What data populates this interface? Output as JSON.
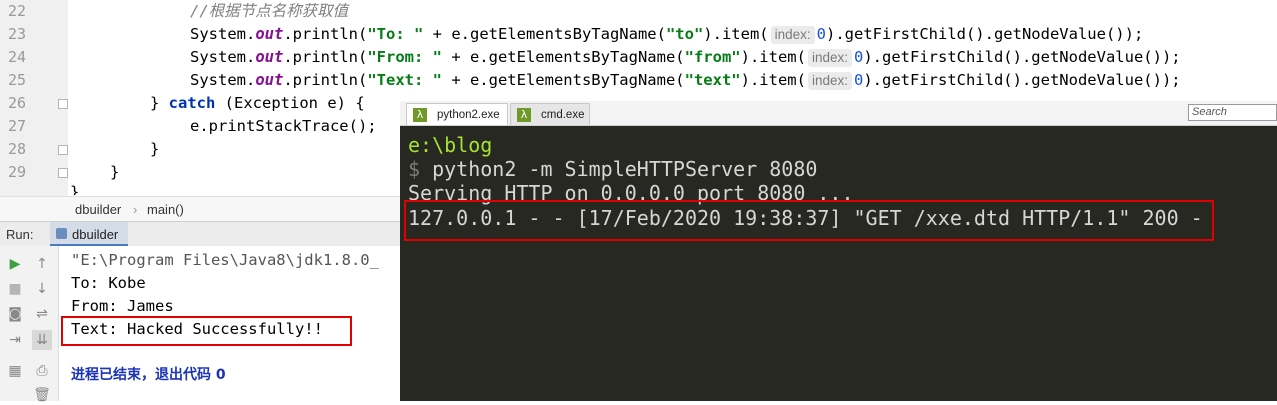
{
  "editor": {
    "line_numbers": [
      "22",
      "23",
      "24",
      "25",
      "26",
      "27",
      "28",
      "29"
    ],
    "comment": "//根据节点名称获取值",
    "hint_label": "index:",
    "line23": {
      "pre": "System.",
      "out": "out",
      "mid": ".println(",
      "str": "\"To: \"",
      "post": " + e.getElementsByTagName(",
      "tag": "\"to\"",
      "item": ").item(",
      "num": "0",
      "end": ").getFirstChild().getNodeValue());"
    },
    "line24": {
      "pre": "System.",
      "out": "out",
      "mid": ".println(",
      "str": "\"From: \"",
      "post": " + e.getElementsByTagName(",
      "tag": "\"from\"",
      "item": ").item(",
      "num": "0",
      "end": ").getFirstChild().getNodeValue());"
    },
    "line25": {
      "pre": "System.",
      "out": "out",
      "mid": ".println(",
      "str": "\"Text: \"",
      "post": " + e.getElementsByTagName(",
      "tag": "\"text\"",
      "item": ").item(",
      "num": "0",
      "end": ").getFirstChild().getNodeValue());"
    },
    "line26": {
      "brace": "} ",
      "kw": "catch",
      "rest": " (Exception e) {"
    },
    "line27": "e.printStackTrace();",
    "line28": "}",
    "line29": "}",
    "line30": "}"
  },
  "breadcrumb": {
    "file": "dbuilder",
    "sep": "›",
    "method": "main()"
  },
  "run": {
    "label": "Run:",
    "tab": "dbuilder",
    "output": [
      "\"E:\\Program Files\\Java8\\jdk1.8.0_",
      "To: Kobe",
      "From: James",
      "Text: Hacked Successfully!!"
    ],
    "exit_message": "进程已结束，退出代码 0"
  },
  "terminal": {
    "tabs": [
      "python2.exe",
      "cmd.exe"
    ],
    "search_placeholder": "Search",
    "tab_icon": "λ",
    "cwd": "e:\\blog",
    "prompt_symbol": "$",
    "command": " python2 -m SimpleHTTPServer 8080",
    "serving": "Serving HTTP on 0.0.0.0 port 8080 ...",
    "request_log": "127.0.0.1 - - [17/Feb/2020 19:38:37] \"GET /xxe.dtd HTTP/1.1\" 200 -"
  },
  "colors": {
    "highlight": "#e00000",
    "terminal_bg": "#272822",
    "cwd": "#a6e22e"
  }
}
